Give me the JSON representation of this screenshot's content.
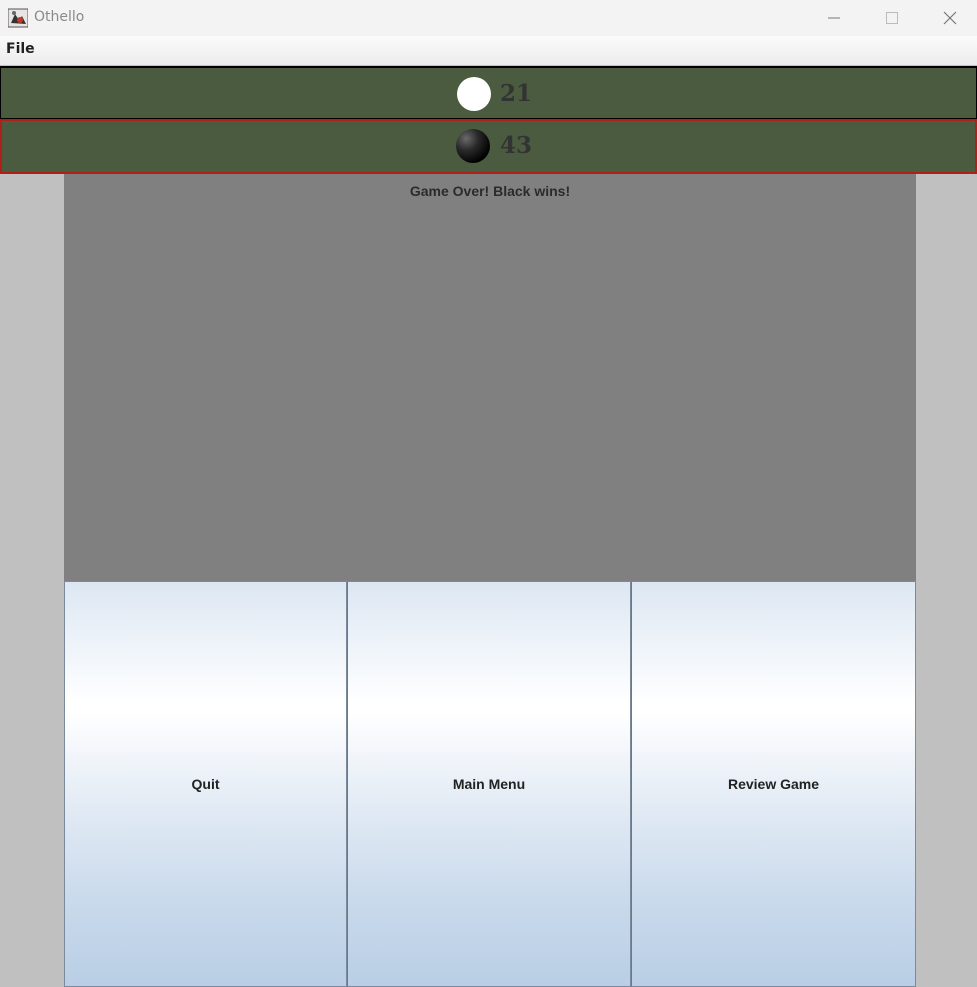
{
  "window": {
    "title": "Othello"
  },
  "menubar": {
    "file_label": "File"
  },
  "scores": {
    "white": "21",
    "black": "43"
  },
  "status": {
    "message": "Game Over! Black wins!"
  },
  "buttons": {
    "quit": "Quit",
    "main_menu": "Main Menu",
    "review_game": "Review Game"
  },
  "colors": {
    "score_panel": "#4a5b3f",
    "active_border": "#b0201a",
    "board": "#808080",
    "background": "#c0c0c0"
  }
}
